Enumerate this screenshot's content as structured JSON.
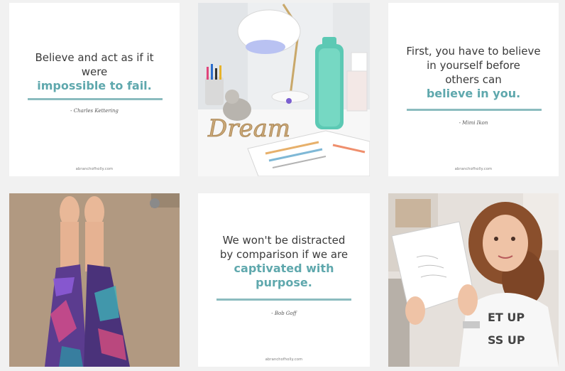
{
  "tiles": [
    {
      "type": "quote",
      "lines": [
        "Believe and act as if it",
        "were"
      ],
      "accent_lines": [
        "impossible to fail."
      ],
      "author": "- Charles Kettering",
      "site": "abranchofholly.com"
    },
    {
      "type": "photo",
      "photo_text": "Dream"
    },
    {
      "type": "quote",
      "lines": [
        "First, you have to believe",
        "in yourself before",
        "others can"
      ],
      "accent_lines": [
        "believe in you."
      ],
      "author": "- Mimi Ikon",
      "site": "abranchofholly.com"
    },
    {
      "type": "photo"
    },
    {
      "type": "quote",
      "lines": [
        "We won't be distracted",
        "by comparison if we are"
      ],
      "accent_lines": [
        "captivated with",
        "purpose."
      ],
      "author": "- Bob Goff",
      "site": "abranchofholly.com"
    },
    {
      "type": "photo",
      "shirt_text": [
        "ET UP",
        "SS UP"
      ]
    }
  ],
  "colors": {
    "accent": "#5fa8ad",
    "rule": "#8bbcbf",
    "background": "#f1f1f1"
  }
}
